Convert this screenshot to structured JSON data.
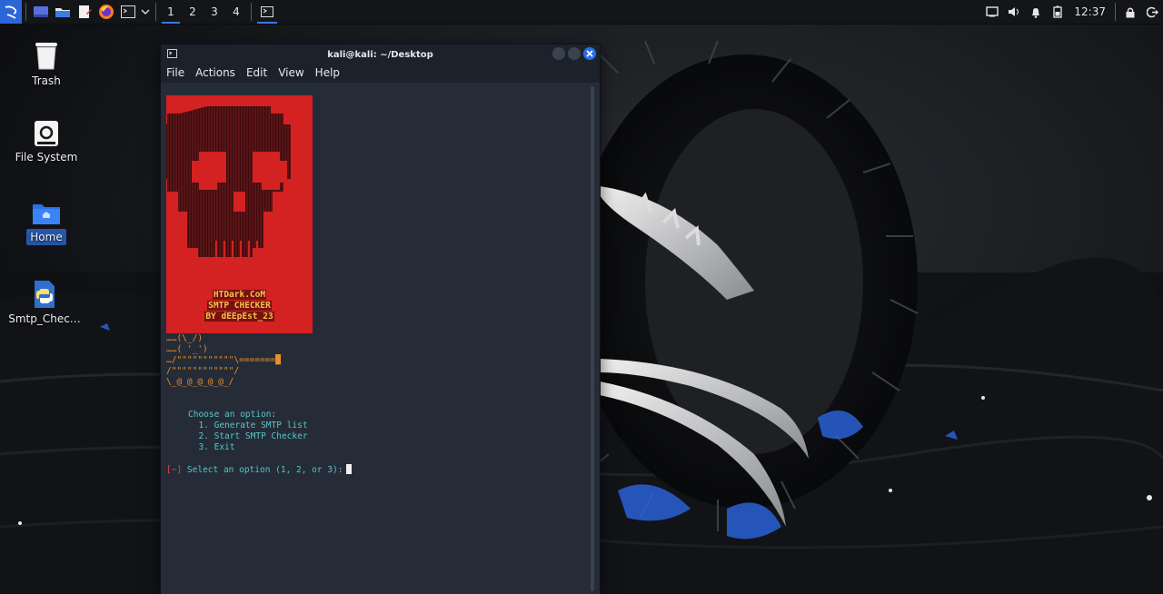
{
  "panel": {
    "workspaces": [
      "1",
      "2",
      "3",
      "4"
    ],
    "clock": "12:37",
    "icons": [
      "kali-menu-icon",
      "desktop-icon",
      "file-manager-icon",
      "text-editor-icon",
      "firefox-icon",
      "terminal-icon",
      "chevron-down-icon"
    ]
  },
  "desktop": {
    "icons": [
      {
        "label": "Trash"
      },
      {
        "label": "File System"
      },
      {
        "label": "Home"
      },
      {
        "label": "Smtp_Chec…"
      }
    ]
  },
  "terminal": {
    "title": "kali@kali: ~/Desktop",
    "menu": [
      "File",
      "Actions",
      "Edit",
      "View",
      "Help"
    ],
    "banner": [
      "HTDark.CoM",
      "SMTP CHECKER",
      "BY dEEpEst_23"
    ],
    "ascii": [
      "……(\\_/)",
      "……( '_')",
      "…/\"\"\"\"\"\"\"\"\"\"\"\\=======█",
      "/\"\"\"\"\"\"\"\"\"\"\"\"/",
      "\\_@_@_@_@_@_/"
    ],
    "menu_prompt": "Choose an option:",
    "options": [
      "1. Generate SMTP list",
      "2. Start SMTP Checker",
      "3. Exit"
    ],
    "prompt_prefix": "[~]",
    "prompt_text": "Select an option (1, 2, or 3):"
  },
  "colors": {
    "accent": "#367bf0",
    "terminal_bg": "#252c38",
    "banner_red": "#d42121",
    "banner_text": "#f3c24a",
    "ascii_orange": "#e8902a",
    "menu_cyan": "#58c6c6",
    "prompt_red": "#e04848"
  }
}
